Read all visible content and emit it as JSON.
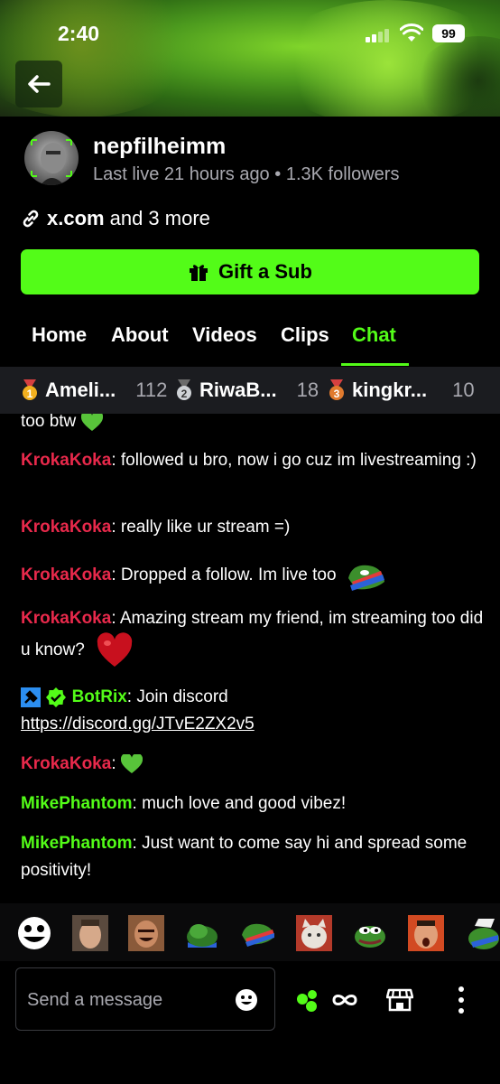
{
  "status_bar": {
    "time": "2:40",
    "battery": "99"
  },
  "channel": {
    "username": "nepfilheimm",
    "last_live": "Last live 21 hours ago",
    "separator": "•",
    "followers": "1.3K followers",
    "link_primary": "x.com",
    "link_more": "and 3 more"
  },
  "gift_button": {
    "label": "Gift a Sub"
  },
  "tabs": [
    {
      "label": "Home"
    },
    {
      "label": "About"
    },
    {
      "label": "Videos"
    },
    {
      "label": "Clips"
    },
    {
      "label": "Chat",
      "active": true
    }
  ],
  "leaderboard": [
    {
      "rank": "1",
      "name": "Ameli...",
      "count": "112"
    },
    {
      "rank": "2",
      "name": "RiwaB...",
      "count": "18"
    },
    {
      "rank": "3",
      "name": "kingkr...",
      "count": "10"
    }
  ],
  "chat": {
    "fragment": "too btw",
    "messages": [
      {
        "user": "KrokaKoka",
        "text": ": followed u bro, now i go cuz im livestreaming :)"
      },
      {
        "user": "KrokaKoka",
        "text": ": really like ur stream =)"
      },
      {
        "user": "KrokaKoka",
        "text": ": Dropped a follow. Im live too"
      },
      {
        "user": "KrokaKoka",
        "text": ": Amazing stream my friend, im streaming too did u know?"
      },
      {
        "user": "BotRix",
        "text": ": Join discord",
        "link": "https://discord.gg/JTvE2ZX2v5"
      },
      {
        "user": "KrokaKoka",
        "text": ":"
      },
      {
        "user": "MikePhantom",
        "text": ": much love and good vibez!"
      },
      {
        "user": "MikePhantom",
        "text": ": Just want to come say hi and spread some positivity!"
      }
    ]
  },
  "input": {
    "placeholder": "Send a message"
  },
  "colors": {
    "accent": "#53fc18",
    "username_red": "#e8294b",
    "muted_text": "#a9a9b0",
    "leaderboard_bg": "#1b1c20"
  },
  "icons": [
    "back-arrow-icon",
    "link-icon",
    "gift-icon",
    "emoji-smile-icon",
    "kicks-icon",
    "infinity-icon",
    "store-icon",
    "more-vertical-icon"
  ]
}
